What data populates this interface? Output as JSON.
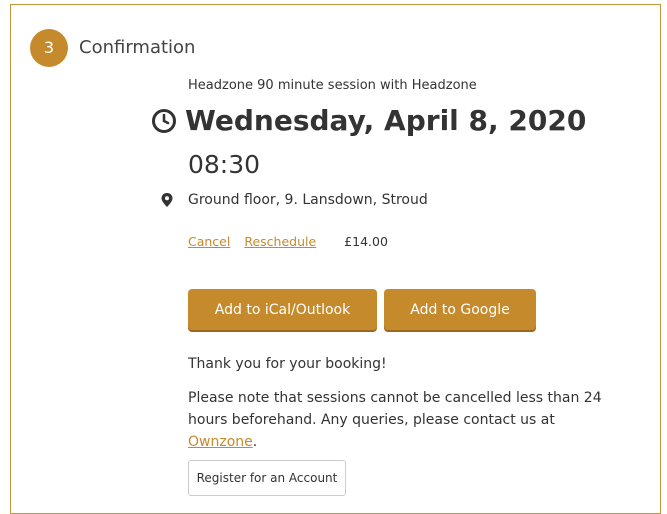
{
  "step": {
    "number": "3",
    "title": "Confirmation"
  },
  "booking": {
    "session_name": "Headzone 90 minute session with Headzone",
    "date": "Wednesday, April 8, 2020",
    "time": "08:30",
    "location": "Ground floor, 9. Lansdown, Stroud",
    "cancel_label": "Cancel",
    "reschedule_label": "Reschedule",
    "price": "£14.00"
  },
  "actions": {
    "ical_label": "Add to iCal/Outlook",
    "google_label": "Add to Google",
    "register_label": "Register for an Account"
  },
  "messages": {
    "thanks": "Thank you for your booking!",
    "note_prefix": "Please note that sessions cannot be cancelled less than 24 hours beforehand. Any queries, please contact us at ",
    "note_link": "Ownzone",
    "note_suffix": "."
  },
  "icons": {
    "clock": "clock-icon",
    "location": "map-pin-icon"
  },
  "colors": {
    "accent": "#c58a2c",
    "border": "#c8953b",
    "text": "#333333"
  }
}
